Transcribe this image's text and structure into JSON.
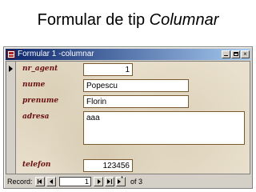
{
  "slide": {
    "title_prefix": "Formular de tip ",
    "title_em": "Columnar"
  },
  "window": {
    "title": "Formular 1 -columnar",
    "buttons": {
      "minimize": "minimize-icon",
      "maximize": "maximize-icon",
      "close_label": "×"
    }
  },
  "form": {
    "fields": [
      {
        "label": "nr_agent",
        "value": "1"
      },
      {
        "label": "nume",
        "value": "Popescu"
      },
      {
        "label": "prenume",
        "value": "Florin"
      },
      {
        "label": "adresa",
        "value": "aaa"
      },
      {
        "label": "telefon",
        "value": "123456"
      }
    ]
  },
  "navigation": {
    "label": "Record:",
    "current": "1",
    "of_text": "of  3",
    "icons": [
      "first-record-icon",
      "prev-record-icon",
      "next-record-icon",
      "last-record-icon",
      "new-record-icon"
    ]
  },
  "colors": {
    "titlebar": "#0a246a",
    "label": "#6a1010",
    "form_background": "#e8dfcc"
  }
}
